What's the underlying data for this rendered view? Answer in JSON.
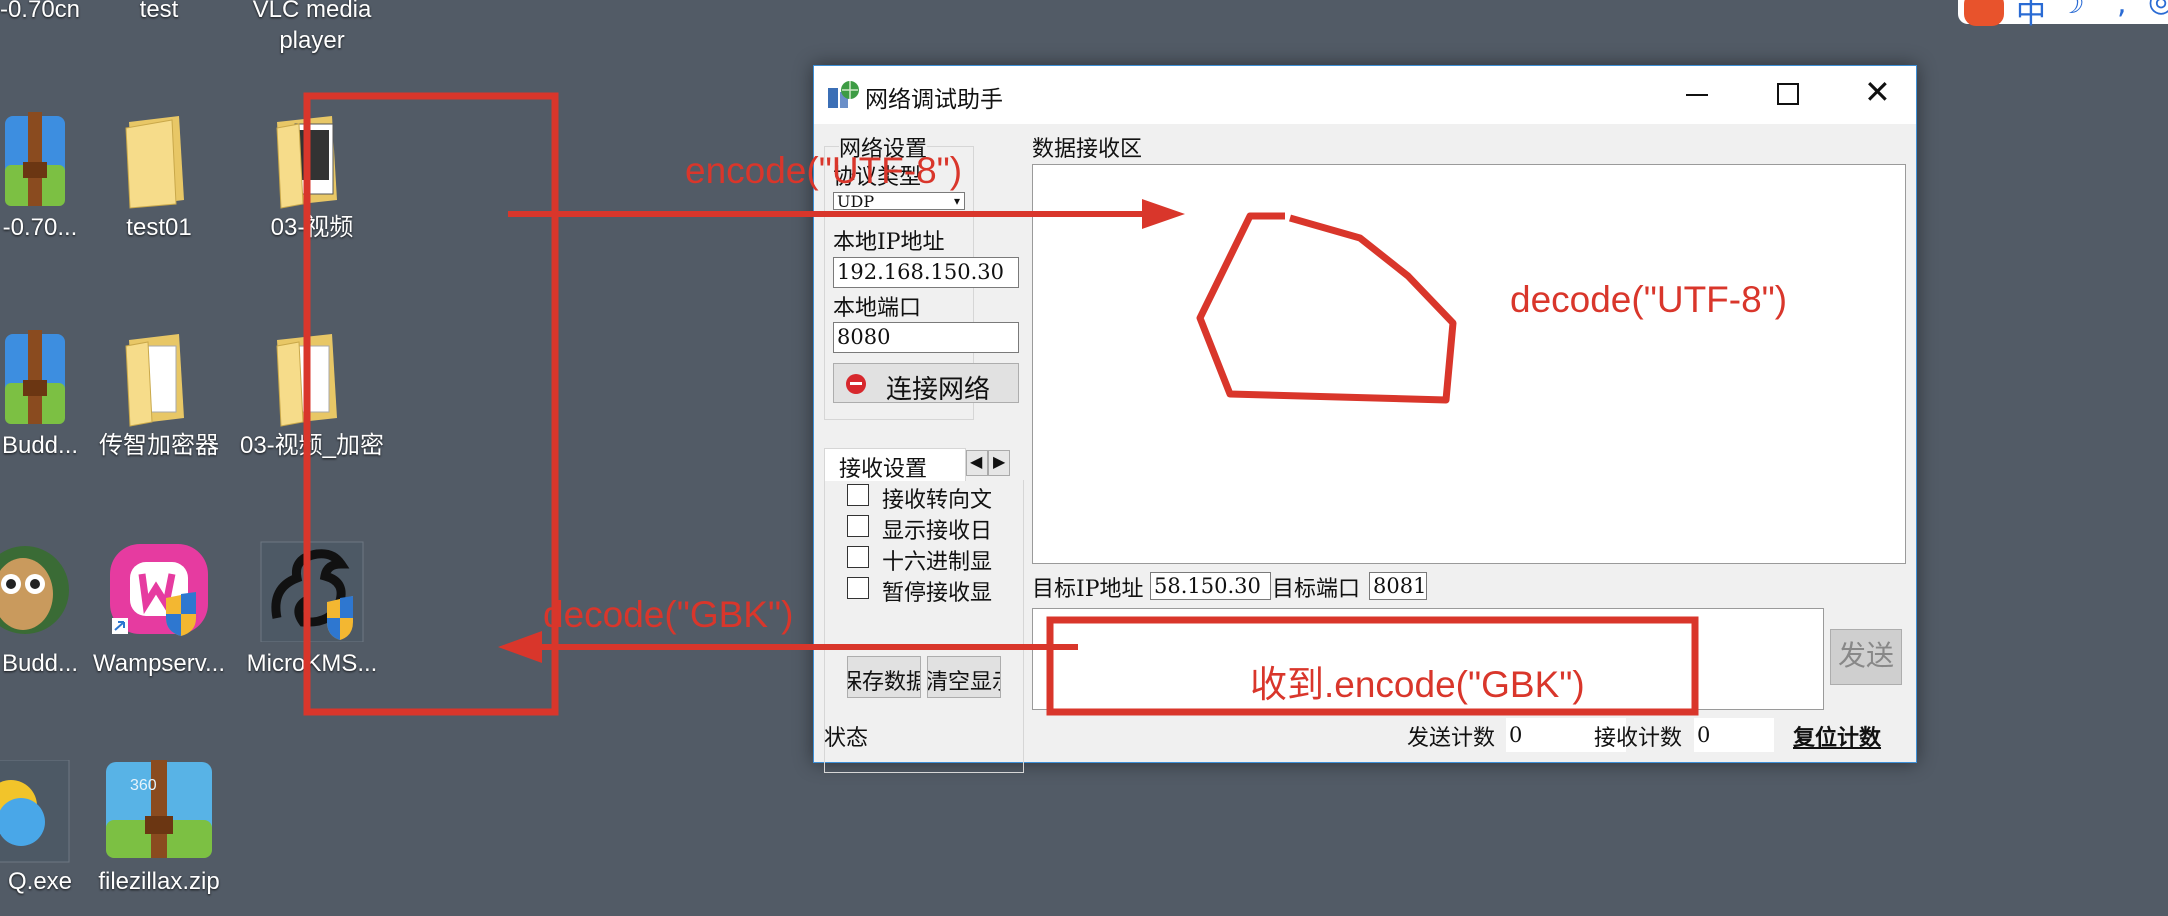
{
  "desktop": {
    "icons": [
      {
        "label": "-0.70cn"
      },
      {
        "label": "test"
      },
      {
        "label": "VLC media player"
      },
      {
        "label": "-0.70..."
      },
      {
        "label": "test01"
      },
      {
        "label": "03-视频"
      },
      {
        "label": "Budd..."
      },
      {
        "label": "传智加密器"
      },
      {
        "label": "03-视频_加密"
      },
      {
        "label": "Budd..."
      },
      {
        "label": "Wampserv..."
      },
      {
        "label": "MicroKMS..."
      },
      {
        "label": "Q.exe"
      },
      {
        "label": "filezillax.zip"
      }
    ],
    "tray_text": "中"
  },
  "window": {
    "title": "网络调试助手",
    "net_settings": {
      "group_label": "网络设置",
      "protocol_label": "协议类型",
      "protocol_value": "UDP",
      "local_ip_label": "本地IP地址",
      "local_ip_value": "192.168.150.30",
      "local_port_label": "本地端口",
      "local_port_value": "8080",
      "connect_label": "连接网络"
    },
    "recv_settings": {
      "tab_label": "接收设置",
      "options": [
        "接收转向文",
        "显示接收日",
        "十六进制显",
        "暂停接收显"
      ],
      "save_label": "保存数据",
      "clear_label": "清空显示"
    },
    "recv_area_label": "数据接收区",
    "target_ip_label": "目标IP地址",
    "target_ip_value": "58.150.30",
    "target_port_label": "目标端口",
    "target_port_value": "8081",
    "send_label": "发送",
    "status": {
      "state_label": "状态",
      "send_count_label": "发送计数",
      "send_count": "0",
      "recv_count_label": "接收计数",
      "recv_count": "0",
      "reset_label": "复位计数"
    }
  },
  "annotations": {
    "encode_utf8": "encode(\"UTF-8\")",
    "decode_utf8": "decode(\"UTF-8\")",
    "decode_gbk": "decode(\"GBK\")",
    "recv_encode_gbk": "收到.encode(\"GBK\")",
    "color": "#d9362b"
  }
}
